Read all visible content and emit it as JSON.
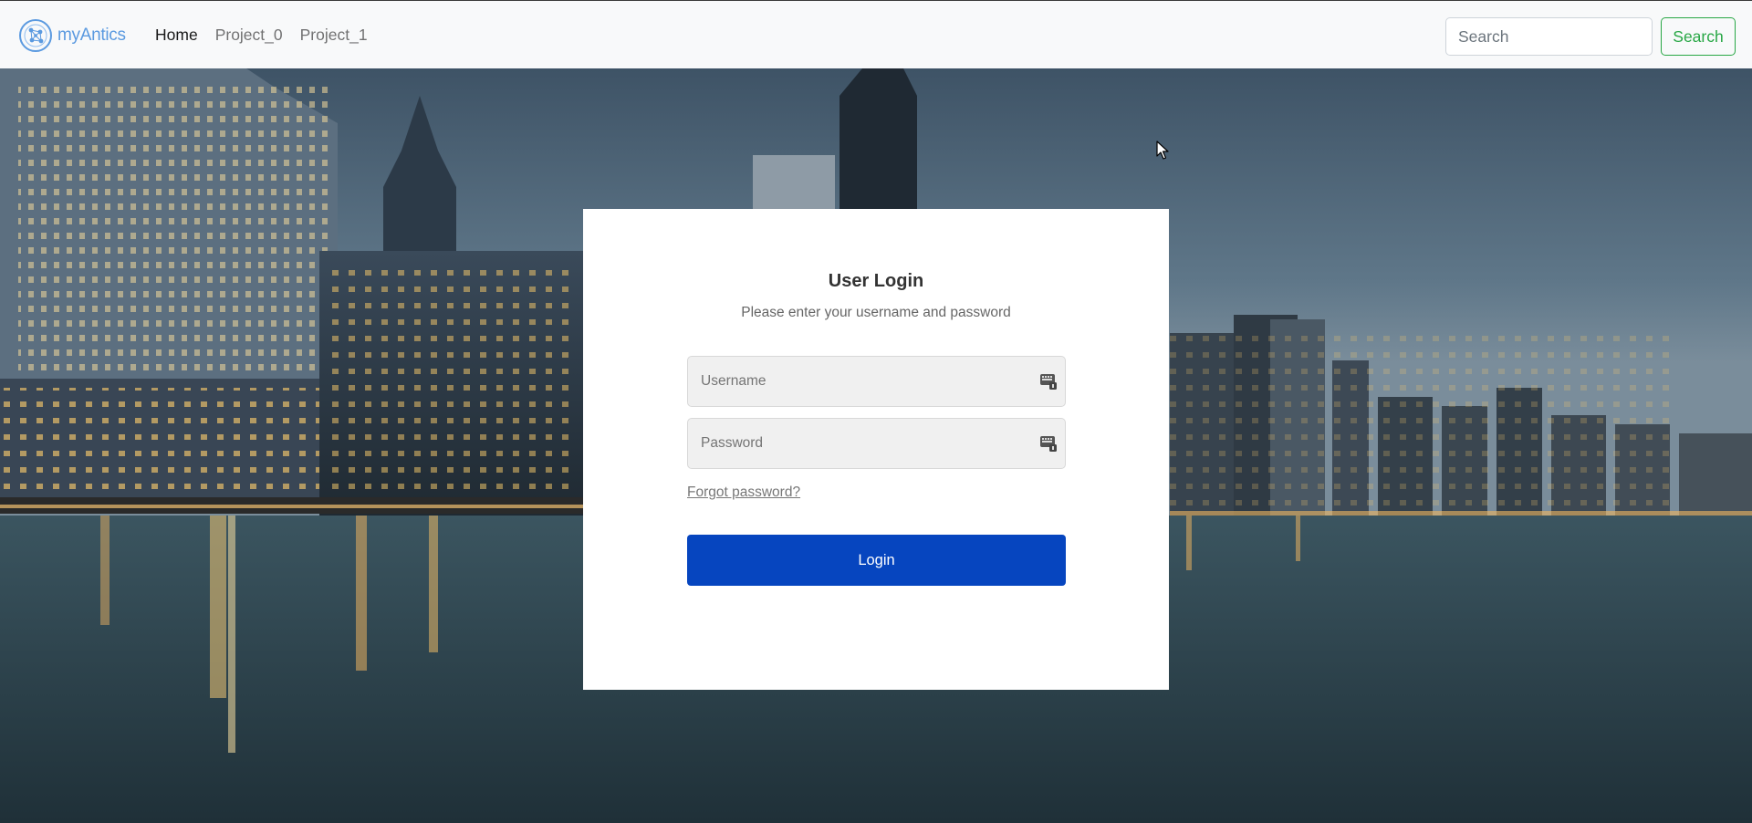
{
  "navbar": {
    "brand_text": "myAntics",
    "links": [
      {
        "label": "Home",
        "active": true
      },
      {
        "label": "Project_0",
        "active": false
      },
      {
        "label": "Project_1",
        "active": false
      }
    ],
    "search": {
      "placeholder": "Search",
      "button_label": "Search"
    }
  },
  "login": {
    "title": "User Login",
    "subtitle": "Please enter your username and password",
    "username_placeholder": "Username",
    "password_placeholder": "Password",
    "forgot_label": "Forgot password?",
    "button_label": "Login"
  },
  "colors": {
    "brand": "#5b9ae0",
    "search_accent": "#28a745",
    "primary_button": "#0645bf",
    "navbar_bg": "#f8f9fa"
  },
  "icons": {
    "brand": "network-logo-icon",
    "input_keyboard": "keyboard-icon",
    "cursor": "mouse-pointer-icon"
  }
}
